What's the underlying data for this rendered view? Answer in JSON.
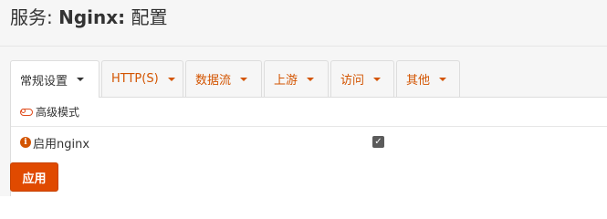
{
  "header": {
    "prefix": "服务: ",
    "service": "Nginx:",
    "suffix": " 配置"
  },
  "tabs": [
    {
      "label": "常规设置",
      "active": true
    },
    {
      "label": "HTTP(S)",
      "active": false
    },
    {
      "label": "数据流",
      "active": false
    },
    {
      "label": "上游",
      "active": false
    },
    {
      "label": "访问",
      "active": false
    },
    {
      "label": "其他",
      "active": false
    }
  ],
  "advanced_mode": {
    "label": "高级模式",
    "icon": "toggle-off-icon"
  },
  "fields": {
    "enable_nginx": {
      "label": "启用nginx",
      "icon": "info-circle-icon",
      "checked": true
    }
  },
  "buttons": {
    "apply": "应用"
  },
  "colors": {
    "accent": "#d35400",
    "button": "#e04a00"
  }
}
